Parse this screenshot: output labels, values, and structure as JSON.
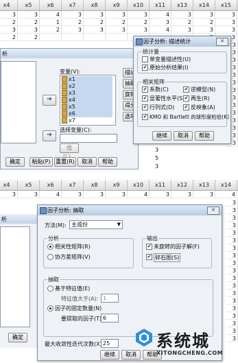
{
  "top": {
    "headers": [
      "x4",
      "x5",
      "x6",
      "x7",
      "x8",
      "x9",
      "x10",
      "x11",
      "x13",
      "x14",
      "x15"
    ],
    "row_values": [
      [
        "3",
        "3",
        "4",
        "3",
        "3",
        "3",
        "3",
        "4",
        "3",
        "3",
        "3"
      ],
      [
        "2",
        "2",
        "1",
        "2",
        "2",
        "2",
        "2",
        "3",
        "2",
        "2",
        "3"
      ],
      [
        "3",
        "3",
        "2",
        "3",
        "3",
        "3",
        "3",
        "4",
        "3",
        "3",
        "3"
      ],
      [
        "2",
        "2",
        "",
        "",
        "",
        "",
        "",
        "",
        "",
        "2",
        "3"
      ]
    ],
    "right_col": [
      "3",
      "3",
      "3",
      "3",
      "3",
      "3",
      "3",
      "3",
      "3",
      "3",
      "3",
      "3",
      "3",
      "3",
      "3",
      "3",
      "3"
    ],
    "left_hint": "析",
    "main_dialog": {
      "var_label": "变量(V):",
      "vars": [
        "x1",
        "x2",
        "x3",
        "x4",
        "x5",
        "x6",
        "x7"
      ],
      "select_label": "选择变量(C):",
      "value_button": "值(L)...",
      "side_buttons": [
        "描述",
        "抽取",
        "旋转",
        "得分",
        "选项"
      ],
      "buttons": [
        "确定",
        "粘贴(P)",
        "重置(R)",
        "取消",
        "帮助"
      ]
    },
    "desc_dialog": {
      "title": "因子分析: 描述统计",
      "stats_group": "统计量",
      "stats": [
        {
          "label": "单变量描述性(U)",
          "checked": false
        },
        {
          "label": "原始分析结果(I)",
          "checked": true
        }
      ],
      "matrix_group": "相关矩阵",
      "matrix_items": [
        {
          "label": "系数(C)",
          "checked": true
        },
        {
          "label": "逆模型(N)",
          "checked": true
        },
        {
          "label": "显著性水平(S)",
          "checked": true
        },
        {
          "label": "再生(R)",
          "checked": true
        },
        {
          "label": "行列式(D)",
          "checked": true
        },
        {
          "label": "反映象(A)",
          "checked": true
        },
        {
          "label": "KMO 和 Bartlett 的球形度检验(K)",
          "checked": true
        }
      ],
      "buttons": [
        "继续",
        "取消",
        "帮助"
      ]
    },
    "bottom_values": [
      "3",
      "5",
      "3"
    ]
  },
  "bottom": {
    "headers": [
      "x4",
      "x5",
      "x6",
      "x7",
      "x8",
      "x9",
      "x10",
      "x11",
      "x12",
      "x13",
      "x14"
    ],
    "first_row": [
      "3",
      "3",
      "4",
      "3",
      "3",
      "3",
      "4",
      "3",
      "3",
      "3",
      "4"
    ],
    "left_hint": "析",
    "ok_button": "确定",
    "extract_dialog": {
      "title": "因子分析: 抽取",
      "method_label": "方法(M):",
      "method_value": "主成份",
      "analysis_group": "分析",
      "analysis_options": [
        {
          "label": "相关性矩阵(R)",
          "selected": true
        },
        {
          "label": "协方差矩阵(V)",
          "selected": false
        }
      ],
      "output_group": "输出",
      "output_options": [
        {
          "label": "未旋转的因子解(F)",
          "checked": true
        },
        {
          "label": "碎石图(S)",
          "checked": true
        }
      ],
      "extract_group": "抽取",
      "eigen_option": "基于特征值(E)",
      "eigen_sub_label": "特征值大于(A):",
      "eigen_value": "1",
      "fixed_option": "因子的固定数量(N)",
      "fixed_sub_label": "要提取的因子(T):",
      "fixed_value": "6",
      "iter_label": "最大收敛性迭代次数(X):",
      "iter_value": "25",
      "buttons": [
        "继续",
        "取消",
        "帮助"
      ]
    },
    "right_col": [
      "3",
      "3",
      "3",
      "3",
      "3",
      "3",
      "3",
      "3",
      "3",
      "3",
      "3",
      "3",
      "3",
      "3",
      "3",
      "3",
      "3",
      "3",
      "3",
      "3"
    ]
  },
  "watermark": {
    "brand": "系统城",
    "url": "XITONGCHENG.COM"
  },
  "colors": {
    "dialog_bg": "#eef1f6",
    "title_bar": "#c5d4e8",
    "header_bg": "#e4e4e4"
  }
}
